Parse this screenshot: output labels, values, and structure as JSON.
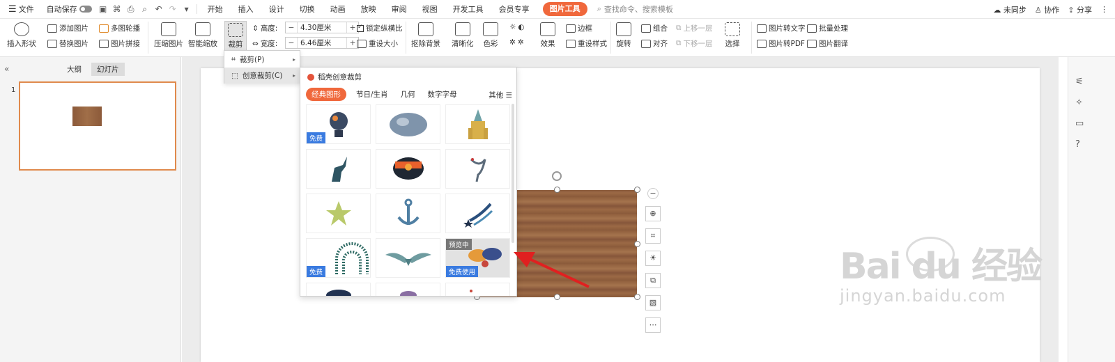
{
  "topbar": {
    "menu": "文件",
    "autosave": "自动保存",
    "tabs": [
      "开始",
      "插入",
      "设计",
      "切换",
      "动画",
      "放映",
      "审阅",
      "视图",
      "开发工具",
      "会员专享"
    ],
    "active_tab": "图片工具",
    "search_placeholder": "查找命令、搜索模板",
    "sync": "未同步",
    "collab": "协作",
    "share": "分享"
  },
  "ribbon": {
    "insert_shape": "插入形状",
    "add_image": "添加图片",
    "replace_image": "替换图片",
    "multi_carousel": "多图轮播",
    "image_splice": "图片拼接",
    "compress": "压缩图片",
    "smart_zoom": "智能缩放",
    "crop": "裁剪",
    "height_label": "高度:",
    "height_value": "4.30厘米",
    "width_label": "宽度:",
    "width_value": "6.46厘米",
    "lock_ratio": "锁定纵横比",
    "reset_size": "重设大小",
    "remove_bg": "抠除背景",
    "sharpen": "清晰化",
    "color": "色彩",
    "effects": "效果",
    "border": "边框",
    "reset_style": "重设样式",
    "rotate": "旋转",
    "group": "组合",
    "align": "对齐",
    "bring_forward": "上移一层",
    "send_backward": "下移一层",
    "select": "选择",
    "img_to_text": "图片转文字",
    "batch": "批量处理",
    "img_to_pdf": "图片转PDF",
    "img_translate": "图片翻译"
  },
  "left_pane": {
    "tab_outline": "大纲",
    "tab_slides": "幻灯片",
    "slide_number": "1"
  },
  "crop_menu": {
    "item_crop": "裁剪(P)",
    "item_creative": "创意裁剪(C)"
  },
  "creative_panel": {
    "title": "稻壳创意裁剪",
    "tabs": [
      "经典图形",
      "节日/生肖",
      "几何",
      "数字字母"
    ],
    "more": "其他",
    "badge_free": "免费",
    "badge_preview": "预览中",
    "badge_free_use": "免费使用"
  },
  "watermark": {
    "main": "Bai du 经验",
    "sub": "jingyan.baidu.com"
  },
  "colors": {
    "accent": "#f0683c",
    "badge_blue": "#3a7be0",
    "arrow_red": "#e02020"
  }
}
